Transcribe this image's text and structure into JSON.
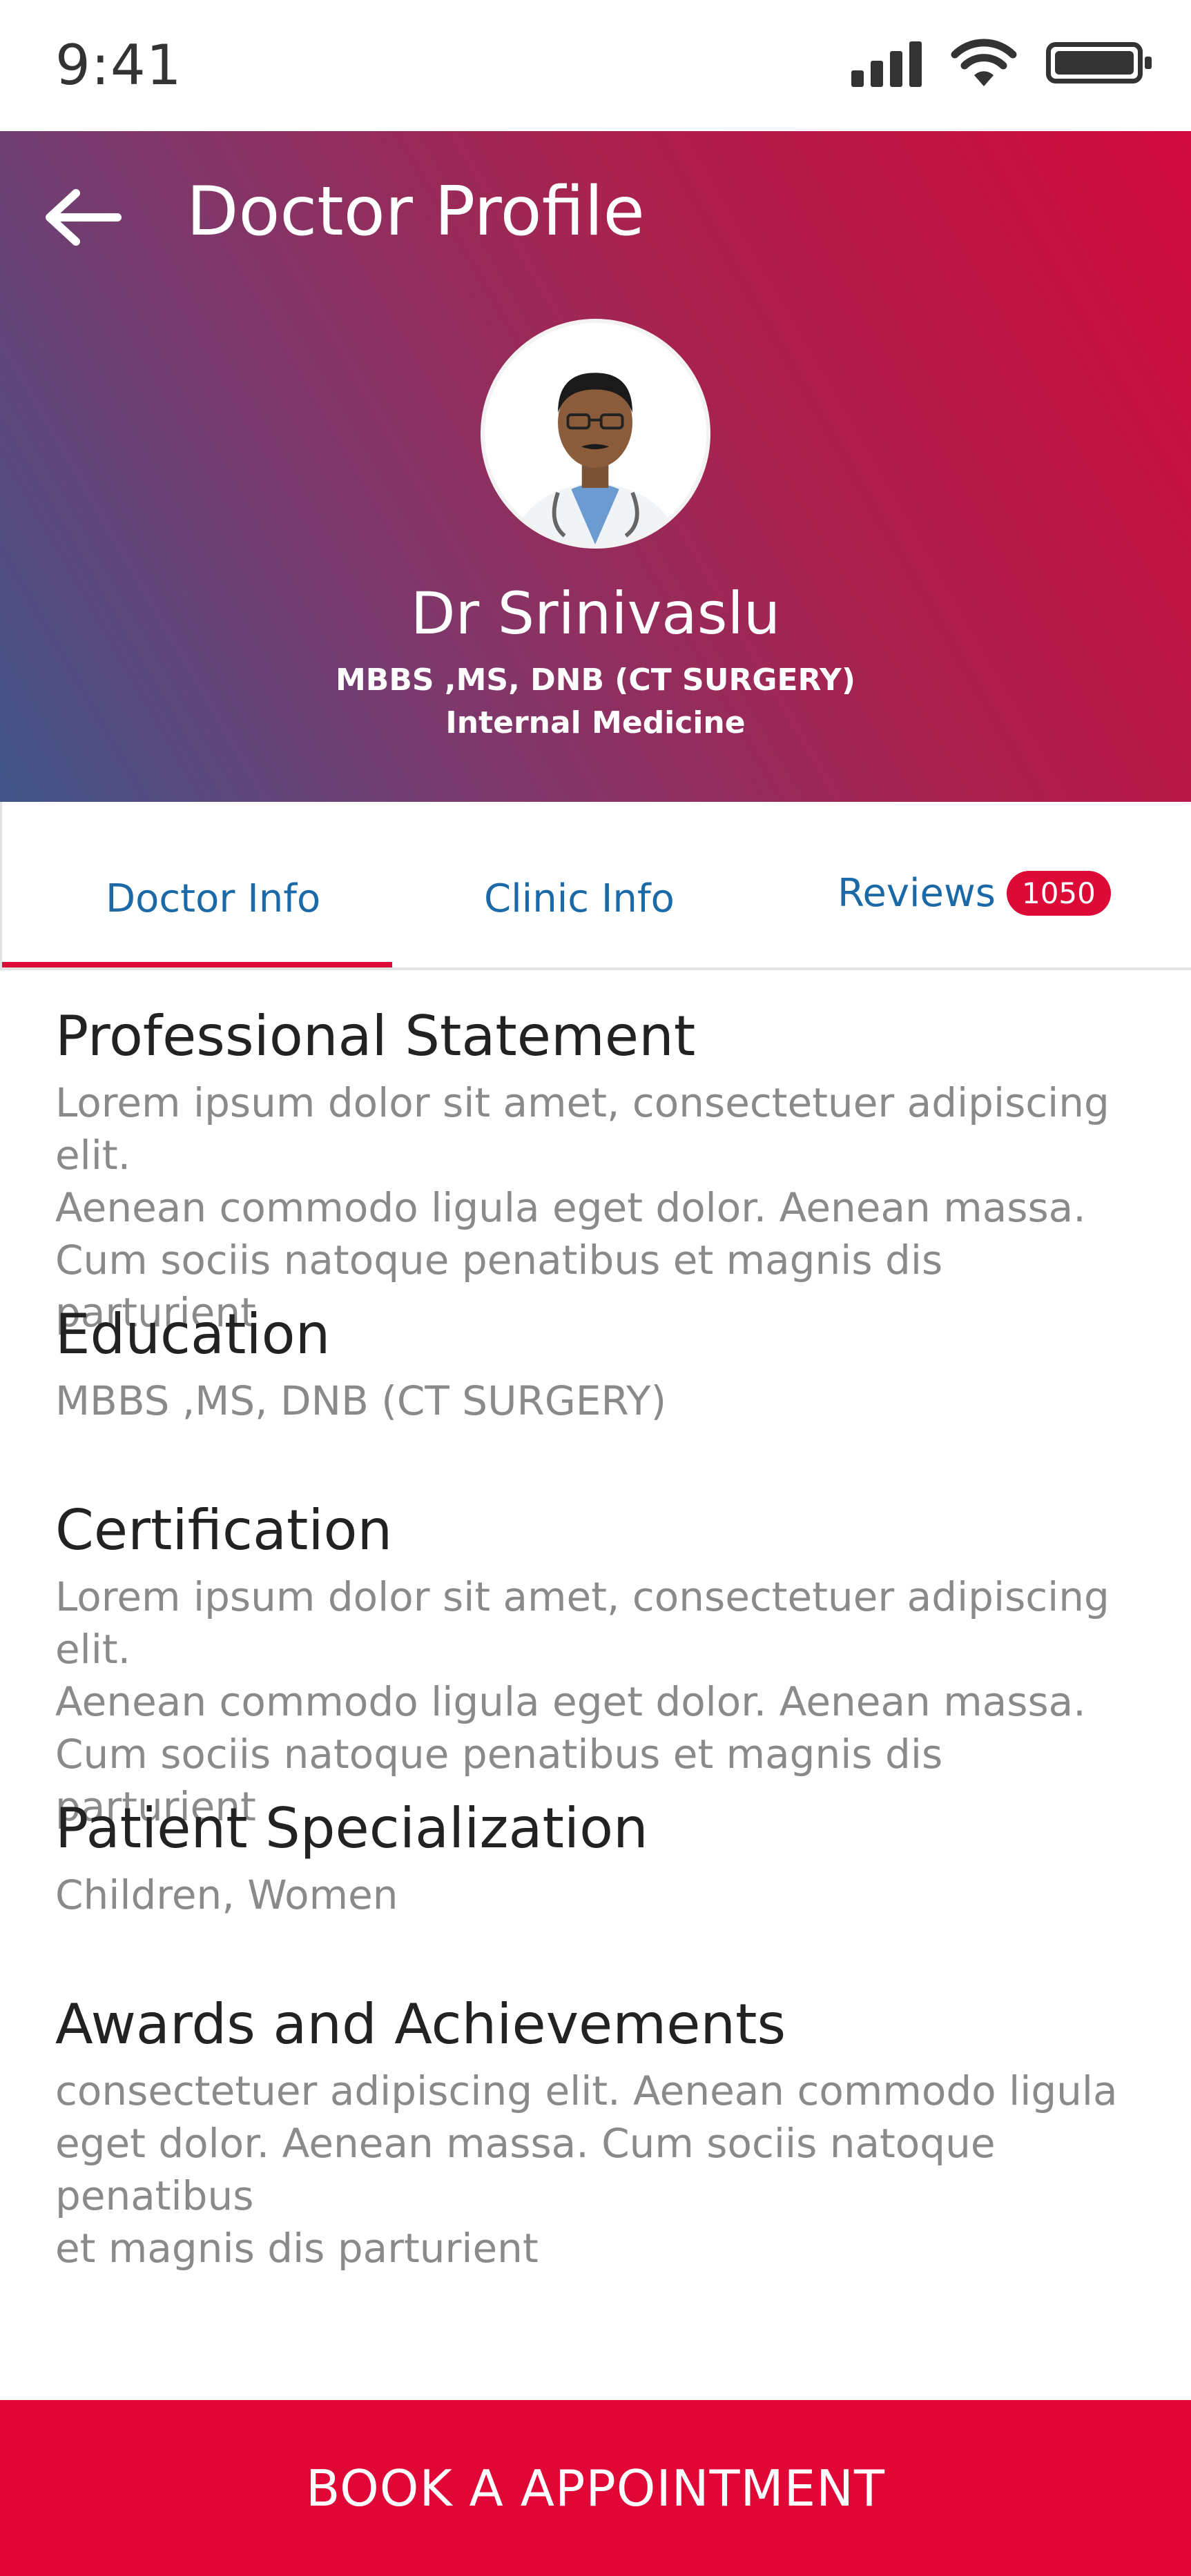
{
  "status_bar": {
    "time": "9:41"
  },
  "header": {
    "title": "Doctor Profile",
    "doctor_name": "Dr Srinivaslu",
    "degree": "MBBS ,MS, DNB (CT SURGERY)",
    "department": "Internal Medicine"
  },
  "tabs": [
    {
      "label": "Doctor Info",
      "active": true
    },
    {
      "label": "Clinic Info",
      "active": false
    },
    {
      "label": "Reviews",
      "badge": "1050",
      "active": false
    }
  ],
  "sections": [
    {
      "title": "Professional Statement",
      "lines": [
        "Lorem ipsum dolor sit amet, consectetuer adipiscing elit.",
        "Aenean commodo ligula eget dolor. Aenean massa.",
        "Cum sociis natoque penatibus et magnis dis parturient"
      ]
    },
    {
      "title": "Education",
      "lines": [
        "MBBS ,MS, DNB (CT SURGERY)"
      ]
    },
    {
      "title": "Certification",
      "lines": [
        "Lorem ipsum dolor sit amet, consectetuer adipiscing elit.",
        "Aenean commodo ligula eget dolor. Aenean massa.",
        "Cum sociis natoque penatibus et magnis dis parturient"
      ]
    },
    {
      "title": "Patient Specialization",
      "lines": [
        "Children, Women"
      ]
    },
    {
      "title": "Awards and Achievements",
      "lines": [
        "consectetuer adipiscing elit. Aenean commodo ligula",
        "eget dolor. Aenean massa. Cum sociis natoque penatibus",
        "et magnis dis parturient"
      ]
    }
  ],
  "book_button": {
    "label": "BOOK A APPOINTMENT"
  },
  "colors": {
    "accent": "#dd0a37",
    "tab_text": "#1b6aa7",
    "gradient_start": "#3f5588",
    "gradient_end": "#d10a3c"
  },
  "icons": [
    "signal-icon",
    "wifi-icon",
    "battery-icon",
    "back-arrow-icon",
    "doctor-avatar"
  ]
}
